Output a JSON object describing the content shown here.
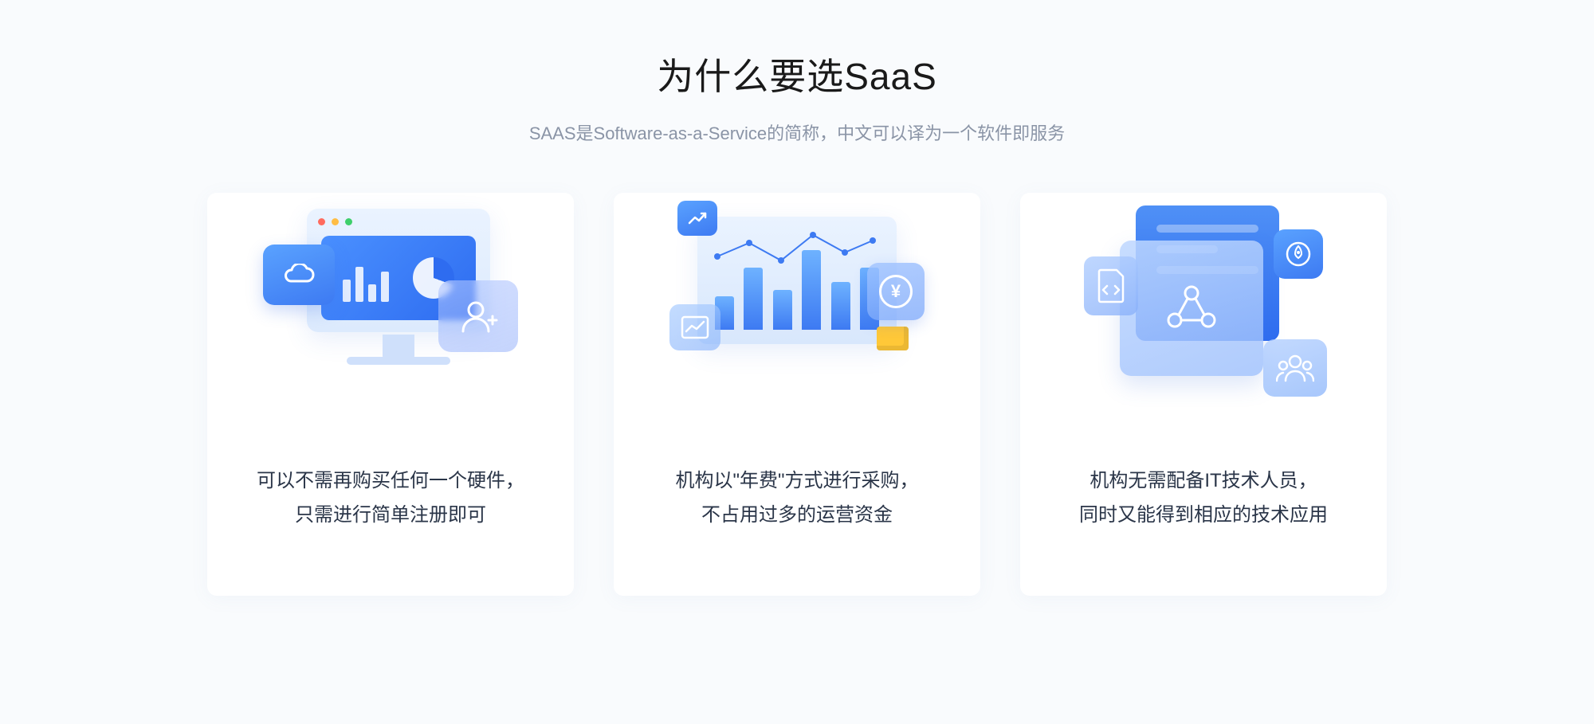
{
  "title": "为什么要选SaaS",
  "subtitle": "SAAS是Software-as-a-Service的简称，中文可以译为一个软件即服务",
  "cards": [
    {
      "line1": "可以不需再购买任何一个硬件，",
      "line2": "只需进行简单注册即可"
    },
    {
      "line1": "机构以\"年费\"方式进行采购，",
      "line2": "不占用过多的运营资金"
    },
    {
      "line1": "机构无需配备IT技术人员，",
      "line2": "同时又能得到相应的技术应用"
    }
  ]
}
